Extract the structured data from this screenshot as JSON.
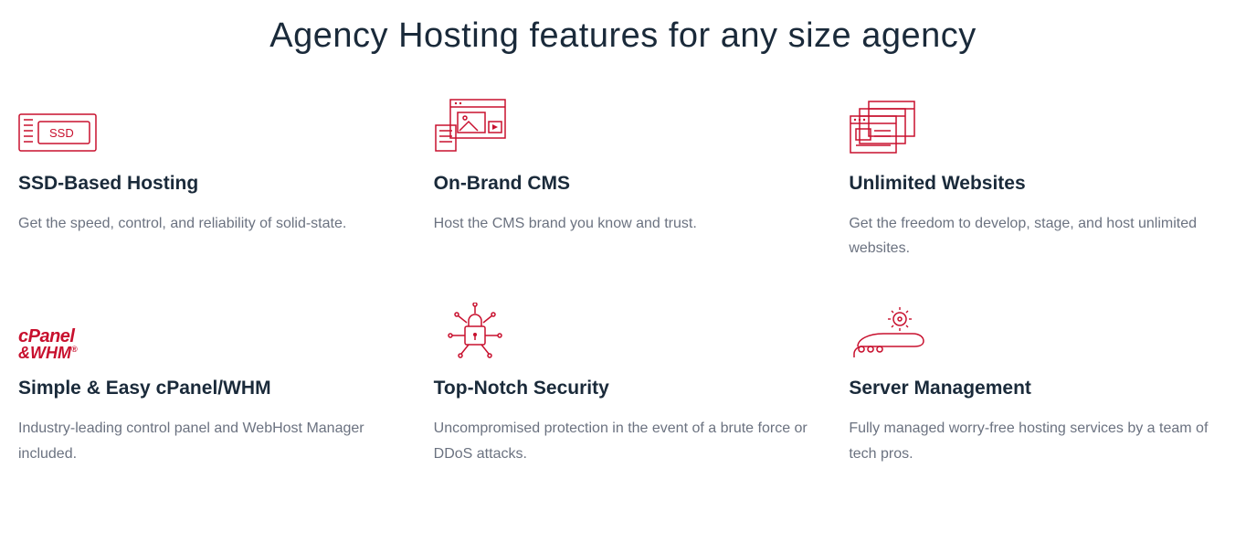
{
  "heading": "Agency Hosting features for any size agency",
  "features": [
    {
      "icon": "ssd-icon",
      "title": "SSD-Based Hosting",
      "desc": "Get the speed, control, and reliability of solid-state."
    },
    {
      "icon": "cms-icon",
      "title": "On-Brand CMS",
      "desc": "Host the CMS brand you know and trust."
    },
    {
      "icon": "websites-icon",
      "title": "Unlimited Websites",
      "desc": "Get the freedom to develop, stage, and host unlimited websites."
    },
    {
      "icon": "cpanel-icon",
      "title": "Simple & Easy cPanel/WHM",
      "desc": "Industry-leading control panel and WebHost Manager included."
    },
    {
      "icon": "security-icon",
      "title": "Top-Notch Security",
      "desc": "Uncompromised protection in the event of a brute force or DDoS attacks."
    },
    {
      "icon": "management-icon",
      "title": "Server Management",
      "desc": "Fully managed worry-free hosting services by a team of tech pros."
    }
  ],
  "colors": {
    "accent": "#c8102e",
    "text": "#1a2a3a",
    "muted": "#6b7280"
  }
}
